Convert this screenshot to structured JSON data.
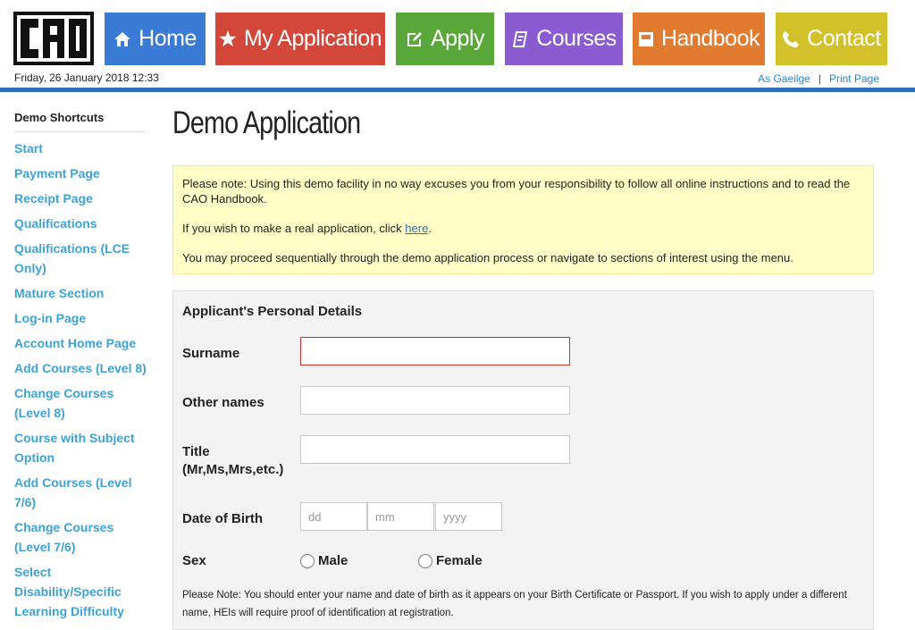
{
  "header": {
    "logo_text": "CAO",
    "nav": [
      {
        "label": "Home",
        "icon": "home-icon",
        "color": "#3a7bd5"
      },
      {
        "label": "My Application",
        "icon": "star-icon",
        "color": "#d3473b"
      },
      {
        "label": "Apply",
        "icon": "edit-icon",
        "color": "#5aa83a"
      },
      {
        "label": "Courses",
        "icon": "book-icon",
        "color": "#8a5bd1"
      },
      {
        "label": "Handbook",
        "icon": "handbook-icon",
        "color": "#e07b2f"
      },
      {
        "label": "Contact",
        "icon": "phone-icon",
        "color": "#d3c12b"
      }
    ],
    "datetime": "Friday, 26 January 2018 12:33",
    "links": {
      "irish": "As Gaeilge",
      "print": "Print Page"
    },
    "rule_color": "#2f6db5"
  },
  "sidebar": {
    "title": "Demo Shortcuts",
    "items": [
      "Start",
      "Payment Page",
      "Receipt Page",
      "Qualifications",
      "Qualifications (LCE Only)",
      "Mature Section",
      "Log-in Page",
      "Account Home Page",
      "Add Courses (Level 8)",
      "Change Courses (Level 8)",
      "Course with Subject Option",
      "Add Courses (Level 7/6)",
      "Change Courses (Level 7/6)",
      "Select Disability/Specific Learning Difficulty"
    ]
  },
  "main": {
    "title": "Demo Application",
    "notice": {
      "p1": "Please note: Using this demo facility in no way excuses you from your responsibility to follow all online instructions and to read the CAO Handbook.",
      "p2_pre": "If you wish to make a real application, click ",
      "p2_link": "here",
      "p2_post": ".",
      "p3": "You may proceed sequentially through the demo application process or navigate to sections of interest using the menu."
    },
    "form": {
      "title": "Applicant's Personal Details",
      "surname_label": "Surname",
      "surname_value": "",
      "other_names_label": "Other names",
      "other_names_value": "",
      "title_label": "Title",
      "title_hint": "(Mr,Ms,Mrs,etc.)",
      "title_value": "",
      "dob_label": "Date of Birth",
      "dob_dd_placeholder": "dd",
      "dob_mm_placeholder": "mm",
      "dob_yyyy_placeholder": "yyyy",
      "sex_label": "Sex",
      "sex_options": [
        "Male",
        "Female"
      ],
      "note": "Please Note: You should enter your name and date of birth as it appears on your Birth Certificate or Passport. If you wish to apply under a different name, HEIs will require proof of identification at registration."
    }
  }
}
